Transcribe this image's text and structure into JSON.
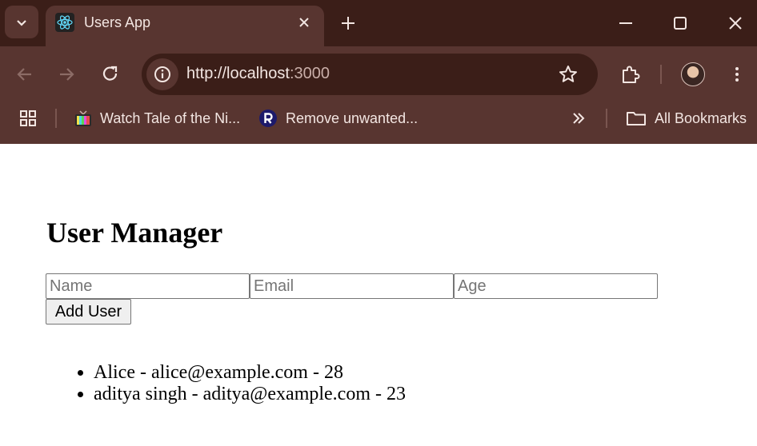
{
  "browser": {
    "tab_title": "Users App",
    "url_host": "http://localhost",
    "url_port": ":3000",
    "bookmarks": [
      {
        "label": "Watch Tale of the Ni...",
        "icon": "tv-favicon-icon"
      },
      {
        "label": "Remove unwanted...",
        "icon": "r-logo-favicon-icon"
      }
    ],
    "all_bookmarks_label": "All Bookmarks",
    "colors": {
      "frame": "#3b1e18",
      "toolbar": "#583530",
      "text": "#f3e6e2"
    }
  },
  "app": {
    "title": "User Manager",
    "form": {
      "name_placeholder": "Name",
      "email_placeholder": "Email",
      "age_placeholder": "Age",
      "name_value": "",
      "email_value": "",
      "age_value": "",
      "submit_label": "Add User"
    },
    "users": [
      {
        "text": "Alice - alice@example.com - 28"
      },
      {
        "text": "aditya singh - aditya@example.com - 23"
      }
    ]
  }
}
